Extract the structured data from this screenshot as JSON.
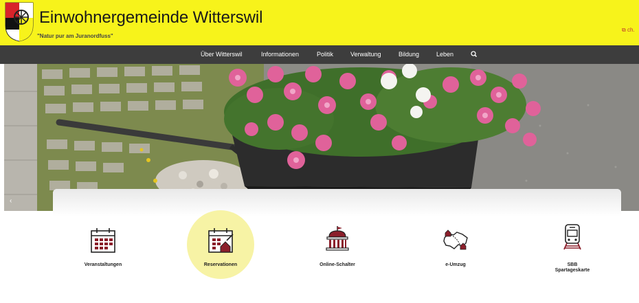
{
  "header": {
    "title": "Einwohnergemeinde Witterswil",
    "tagline": "\"Natur pur am Juranordfuss\"",
    "ext_link": "ch.",
    "logo_icon": "coat-of-arms",
    "bg_color": "#f7f31b"
  },
  "nav": {
    "items": [
      {
        "label": "Über Witterswil"
      },
      {
        "label": "Informationen"
      },
      {
        "label": "Politik"
      },
      {
        "label": "Verwaltung"
      },
      {
        "label": "Bildung"
      },
      {
        "label": "Leben"
      }
    ],
    "search_icon": "search-icon",
    "bg_color": "#3d3d3d"
  },
  "hero": {
    "image": "flower-box-with-pink-and-white-petunias",
    "prev_icon": "chevron-left-icon",
    "prev_glyph": "‹"
  },
  "tiles": [
    {
      "label": "Veranstaltungen",
      "icon": "calendar-icon"
    },
    {
      "label": "Reservationen",
      "icon": "calendar-house-icon",
      "highlighted": true
    },
    {
      "label": "Online-Schalter",
      "icon": "building-icon"
    },
    {
      "label": "e-Umzug",
      "icon": "switzerland-map-icon"
    },
    {
      "label": "SBB Spartageskarte",
      "icon": "train-icon"
    }
  ],
  "accent_color": "#8b1f2b"
}
